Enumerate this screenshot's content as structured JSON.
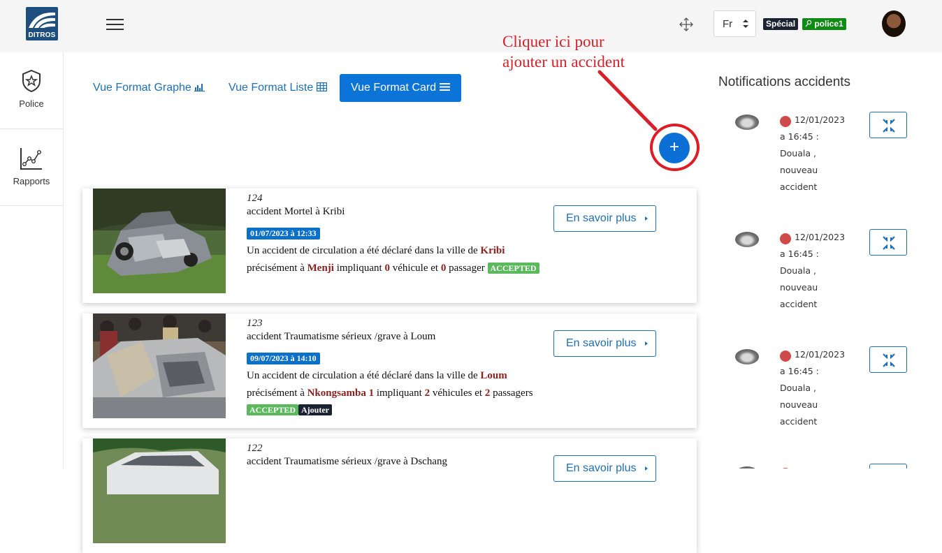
{
  "header": {
    "logo_text": "DITROS",
    "language": "Fr",
    "role_badge": "Spécial",
    "user_badge": "police1"
  },
  "sidebar": {
    "items": [
      {
        "label": "Police",
        "icon": "police-badge-icon"
      },
      {
        "label": "Rapports",
        "icon": "chart-line-icon"
      }
    ]
  },
  "views": {
    "graph": "Vue Format Graphe",
    "list": "Vue Format Liste",
    "card": "Vue Format Card",
    "active": "card"
  },
  "annotation": {
    "line1": "Cliquer ici pour",
    "line2": "ajouter un accident"
  },
  "add_button": {
    "label": "+"
  },
  "accidents": [
    {
      "id": "124",
      "title": "accident Mortel à Kribi",
      "date": "01/07/2023 à 12:33",
      "desc_prefix": "Un accident de circulation a été déclaré dans la ville de",
      "city": "Kribi",
      "precisely": "précisément à",
      "place": "Menji",
      "involving": "impliquant",
      "vehicles": "0",
      "vehicles_word": "véhicule et",
      "passengers": "0",
      "passengers_word": "passager",
      "status": "ACCEPTED",
      "more": "En savoir plus"
    },
    {
      "id": "123",
      "title": "accident Traumatisme sérieux /grave à Loum",
      "date": "09/07/2023 à 14:10",
      "desc_prefix": "Un accident de circulation a été déclaré dans la ville de",
      "city": "Loum",
      "precisely": "précisément à",
      "place": "Nkongsamba 1",
      "involving": "impliquant",
      "vehicles": "2",
      "vehicles_word": "véhicules",
      "and": "et",
      "passengers": "2",
      "passengers_word": "passagers",
      "status": "ACCEPTED",
      "extra_badge": "Ajouter",
      "more": "En savoir plus"
    },
    {
      "id": "122",
      "title": "accident Traumatisme sérieux /grave à Dschang",
      "more": "En savoir plus"
    }
  ],
  "notifications": {
    "title": "Notifications accidents",
    "items": [
      {
        "date": "12/01/2023",
        "time": "a 16:45 :",
        "city": "Douala ,",
        "line3": "nouveau",
        "line4": "accident"
      },
      {
        "date": "12/01/2023",
        "time": "a 16:45 :",
        "city": "Douala ,",
        "line3": "nouveau",
        "line4": "accident"
      },
      {
        "date": "12/01/2023",
        "time": "a 16:45 :",
        "city": "Douala ,",
        "line3": "nouveau",
        "line4": "accident"
      }
    ]
  },
  "colors": {
    "primary": "#0b74d6",
    "link": "#1f6fb2",
    "annotation": "#d8202a",
    "accepted": "#5cb85c",
    "highlight": "#8b1f1f"
  }
}
